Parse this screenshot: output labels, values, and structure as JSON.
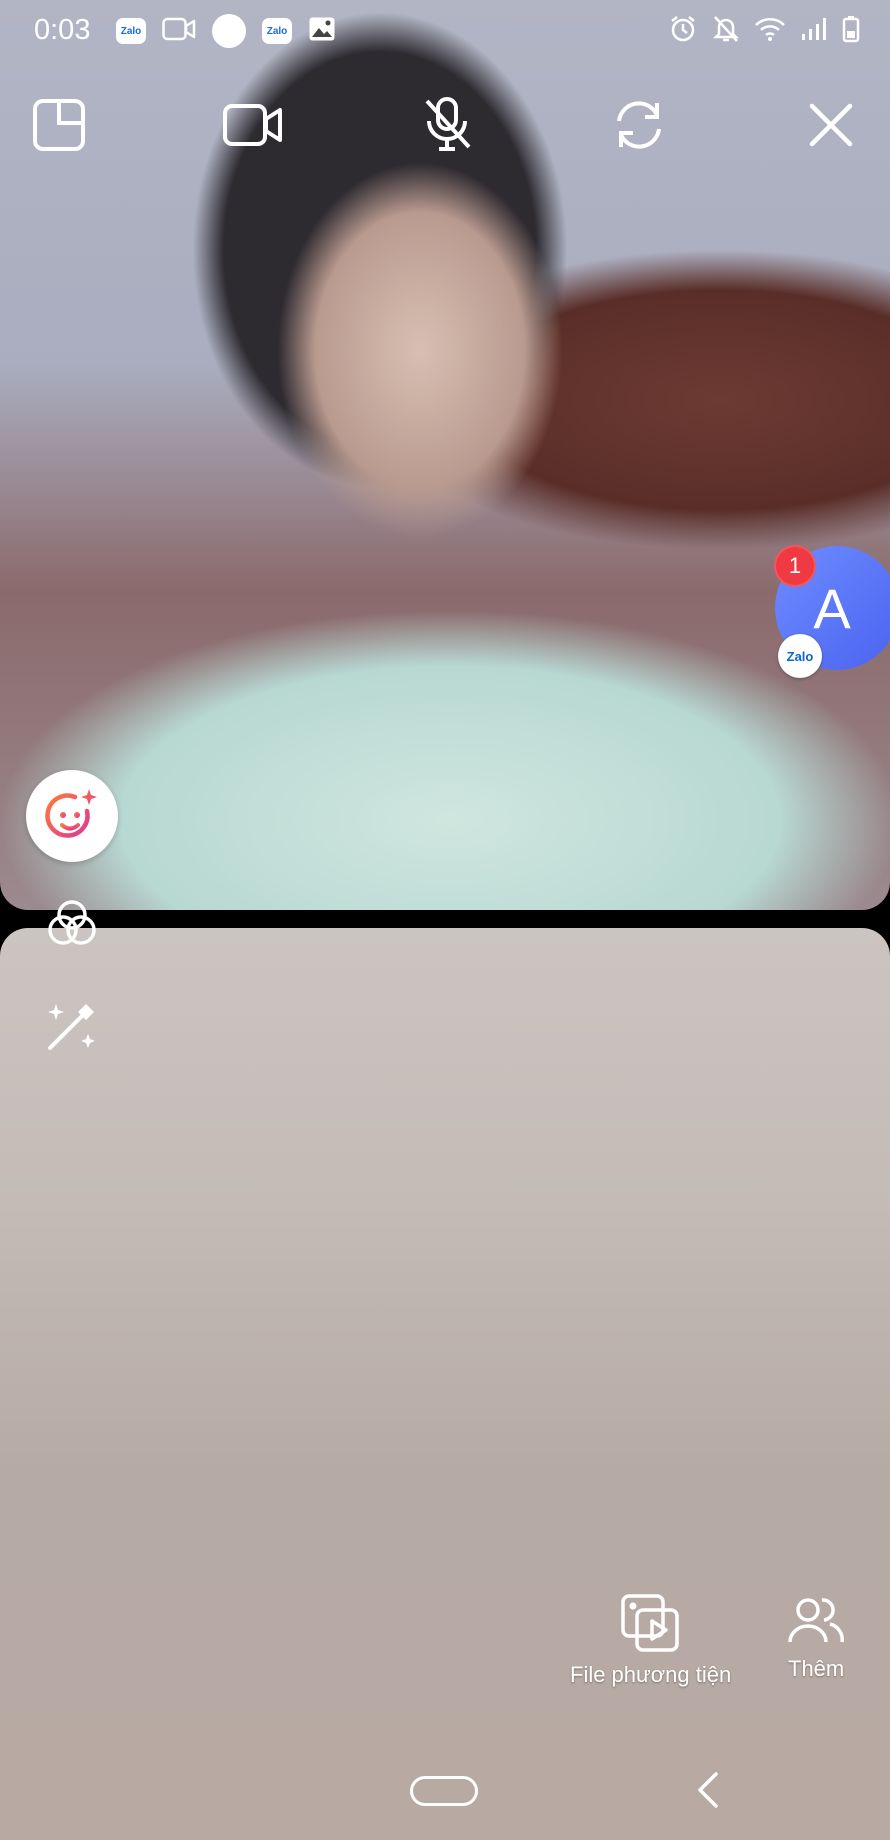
{
  "status_bar": {
    "time": "0:03",
    "notifications": [
      "zalo-icon",
      "video-call-icon",
      "white-dot-icon",
      "zalo-icon",
      "gallery-icon"
    ],
    "zalo_text": "Zalo",
    "right_icons": [
      "alarm-icon",
      "bell-off-icon",
      "wifi-icon",
      "signal-icon",
      "battery-icon"
    ]
  },
  "top_controls": [
    "layout-icon",
    "video-camera-icon",
    "mic-off-icon",
    "switch-camera-icon",
    "close-icon"
  ],
  "contact_bubble": {
    "initial": "A",
    "badge_count": "1",
    "app_badge": "Zalo"
  },
  "side_tools": [
    "beauty-face-icon",
    "filter-icon",
    "magic-wand-icon"
  ],
  "bottom_actions": {
    "media_label": "File phương tiện",
    "more_label": "Thêm"
  },
  "colors": {
    "contact_bubble": "#5a74f5",
    "badge": "#ef3a44",
    "beauty_icon_gradient": [
      "#ff6a3d",
      "#e83a8f"
    ]
  }
}
